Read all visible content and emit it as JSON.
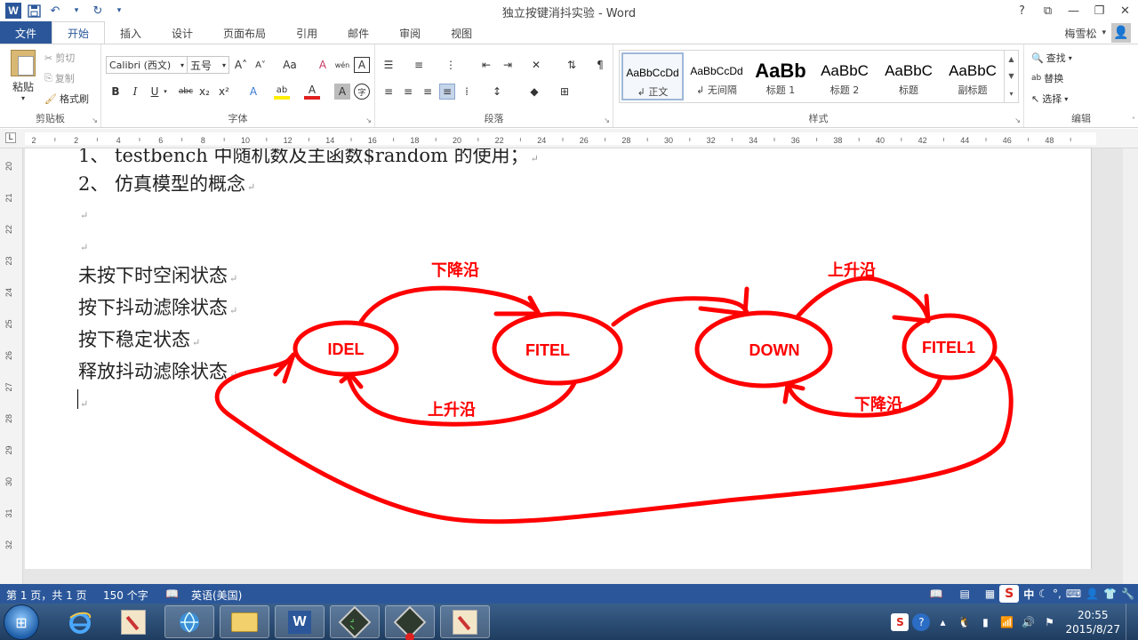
{
  "window": {
    "title": "独立按键消抖实验 - Word",
    "help": "?",
    "ribbon_display": "⧉",
    "minimize": "—",
    "restore": "❐",
    "close": "✕"
  },
  "qat": {
    "save": "💾",
    "undo": "↶",
    "redo": "↻",
    "customize": "▾"
  },
  "tabs": [
    "文件",
    "开始",
    "插入",
    "设计",
    "页面布局",
    "引用",
    "邮件",
    "审阅",
    "视图"
  ],
  "user": {
    "name": "梅雪松",
    "dropdown": "▾"
  },
  "ribbon": {
    "clipboard": {
      "label": "剪贴板",
      "paste": "粘贴",
      "cut": "剪切",
      "copy": "复制",
      "format_painter": "格式刷"
    },
    "font": {
      "label": "字体",
      "font_name": "Calibri (西文)",
      "font_size": "五号",
      "grow": "A˄",
      "shrink": "A˅",
      "case": "Aa",
      "clear": "A",
      "phonetic": "wén",
      "border": "A",
      "bold": "B",
      "italic": "I",
      "underline": "U",
      "strike": "abc",
      "subscript": "x₂",
      "superscript": "x²",
      "effects": "A",
      "highlight": "ab",
      "font_color": "A",
      "shading": "A",
      "enclose": "字"
    },
    "paragraph": {
      "label": "段落"
    },
    "styles": {
      "label": "样式",
      "items": [
        {
          "sample": "AaBbCcDd",
          "name": "↲ 正文"
        },
        {
          "sample": "AaBbCcDd",
          "name": "↲ 无间隔"
        },
        {
          "sample": "AaBb",
          "name": "标题 1"
        },
        {
          "sample": "AaBbC",
          "name": "标题 2"
        },
        {
          "sample": "AaBbC",
          "name": "标题"
        },
        {
          "sample": "AaBbC",
          "name": "副标题"
        }
      ]
    },
    "editing": {
      "label": "编辑",
      "find": "查找",
      "replace": "替换",
      "select": "选择"
    }
  },
  "ruler": {
    "tab_selector": "L",
    "h_ticks": [
      "2",
      "2",
      "4",
      "6",
      "8",
      "10",
      "12",
      "14",
      "16",
      "18",
      "20",
      "22",
      "24",
      "26",
      "28",
      "30",
      "32",
      "34",
      "36",
      "38",
      "40",
      "42",
      "44",
      "46",
      "48"
    ],
    "v_ticks": [
      "20",
      "21",
      "22",
      "23",
      "24",
      "25",
      "26",
      "27",
      "28",
      "29",
      "30",
      "31",
      "32"
    ]
  },
  "document": {
    "lines": [
      "1、 testbench 中随机数及主函数$random 的使用；",
      "2、 仿真模型的概念",
      "",
      "",
      "未按下时空闲状态",
      "按下抖动滤除状态",
      "按下稳定状态",
      "释放抖动滤除状态",
      ""
    ],
    "paragraph_mark": "↵",
    "diagram": {
      "states": [
        "IDEL",
        "FITEL",
        "DOWN",
        "FITEL1"
      ],
      "labels": [
        "下降沿",
        "上升沿",
        "上升沿",
        "下降沿"
      ],
      "color": "#ff0000"
    }
  },
  "status": {
    "page": "第 1 页，共 1 页",
    "words": "150 个字",
    "language": "英语(美国)",
    "ime": "S",
    "ime_mode": "中"
  },
  "taskbar": {
    "time": "20:55",
    "date": "2015/8/27"
  },
  "colors": {
    "accent": "#2b579a",
    "diagram": "#ff0000"
  }
}
